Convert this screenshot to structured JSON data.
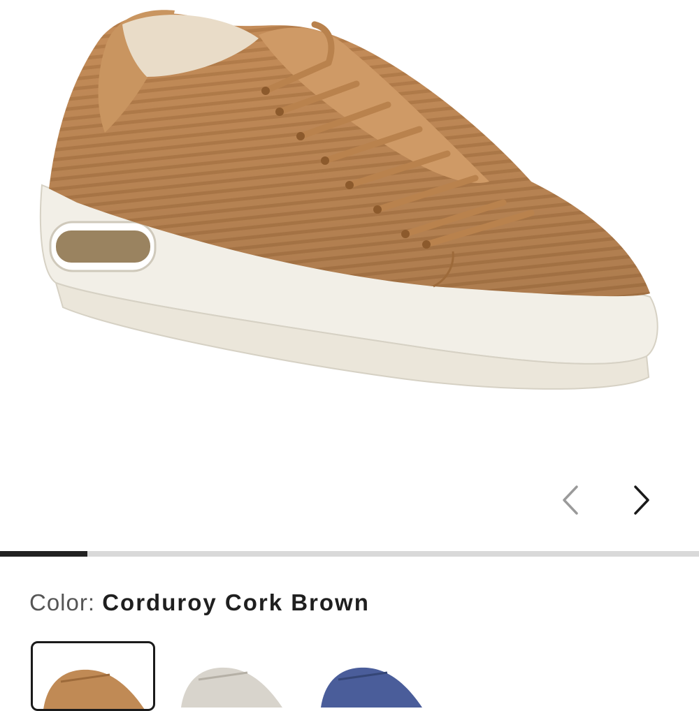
{
  "product": {
    "image_alt": "Corduroy sneaker in cork brown",
    "image_count_progress": 0.125
  },
  "gallery": {
    "prev_icon": "chevron-left-icon",
    "next_icon": "chevron-right-icon"
  },
  "color": {
    "label": "Color:",
    "value": "Corduroy Cork Brown"
  },
  "swatches": [
    {
      "name": "Corduroy Cork Brown",
      "color": "#c08a55",
      "selected": true
    },
    {
      "name": "light",
      "color": "#d8d4cc",
      "selected": false
    },
    {
      "name": "blue",
      "color": "#4a5d9a",
      "selected": false
    }
  ],
  "colors": {
    "upper": "#c58d59",
    "sole": "#f3f0e8",
    "progress_active": "#222222",
    "progress_track": "#d9d9d9"
  }
}
